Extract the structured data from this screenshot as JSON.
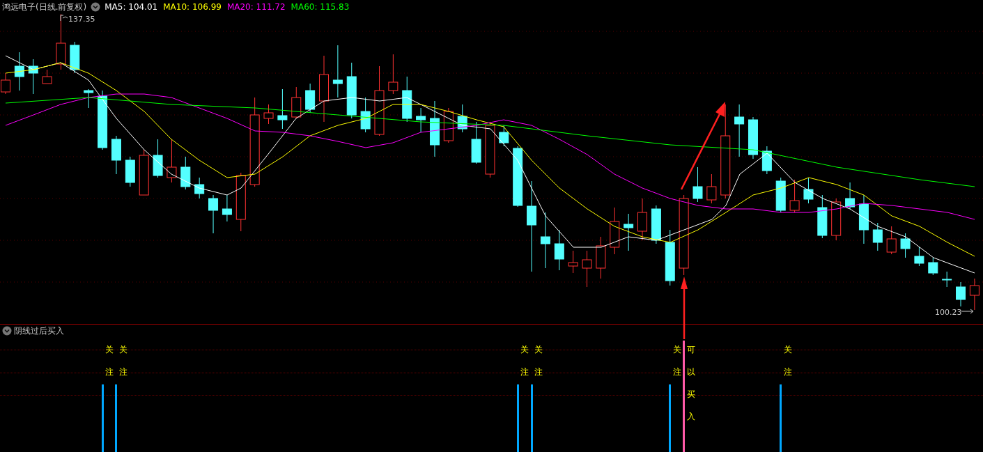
{
  "header": {
    "title": "鸿远电子(日线.前复权)",
    "averages": [
      {
        "label": "MA5: 104.01",
        "color": "#ffffff"
      },
      {
        "label": "MA10: 106.99",
        "color": "#ffff00"
      },
      {
        "label": "MA20: 111.72",
        "color": "#ff00ff"
      },
      {
        "label": "MA60: 115.83",
        "color": "#00ff00"
      }
    ]
  },
  "price_chart": {
    "high_label": "137.35",
    "low_label": "100.23"
  },
  "indicator": {
    "title": "阴线过后买入",
    "signals": [
      {
        "kind": "watch",
        "text": "关注"
      },
      {
        "kind": "watch",
        "text": "关注"
      },
      {
        "kind": "watch",
        "text": "关注"
      },
      {
        "kind": "watch",
        "text": "关注"
      },
      {
        "kind": "watch",
        "text": "关注"
      },
      {
        "kind": "buy",
        "text": "可以买入"
      },
      {
        "kind": "watch",
        "text": "关注"
      }
    ]
  }
}
